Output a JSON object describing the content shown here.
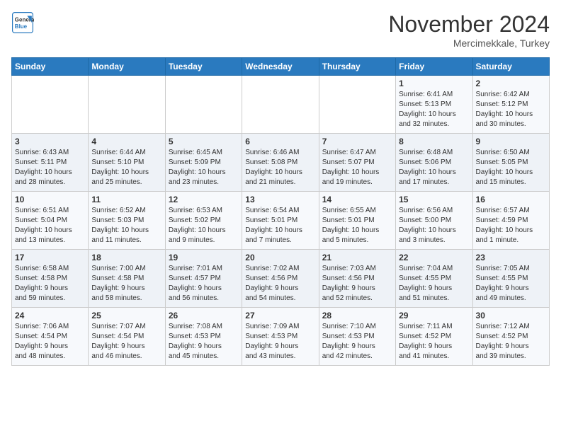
{
  "header": {
    "logo_line1": "General",
    "logo_line2": "Blue",
    "month": "November 2024",
    "location": "Mercimekkale, Turkey"
  },
  "weekdays": [
    "Sunday",
    "Monday",
    "Tuesday",
    "Wednesday",
    "Thursday",
    "Friday",
    "Saturday"
  ],
  "weeks": [
    [
      {
        "day": "",
        "info": ""
      },
      {
        "day": "",
        "info": ""
      },
      {
        "day": "",
        "info": ""
      },
      {
        "day": "",
        "info": ""
      },
      {
        "day": "",
        "info": ""
      },
      {
        "day": "1",
        "info": "Sunrise: 6:41 AM\nSunset: 5:13 PM\nDaylight: 10 hours\nand 32 minutes."
      },
      {
        "day": "2",
        "info": "Sunrise: 6:42 AM\nSunset: 5:12 PM\nDaylight: 10 hours\nand 30 minutes."
      }
    ],
    [
      {
        "day": "3",
        "info": "Sunrise: 6:43 AM\nSunset: 5:11 PM\nDaylight: 10 hours\nand 28 minutes."
      },
      {
        "day": "4",
        "info": "Sunrise: 6:44 AM\nSunset: 5:10 PM\nDaylight: 10 hours\nand 25 minutes."
      },
      {
        "day": "5",
        "info": "Sunrise: 6:45 AM\nSunset: 5:09 PM\nDaylight: 10 hours\nand 23 minutes."
      },
      {
        "day": "6",
        "info": "Sunrise: 6:46 AM\nSunset: 5:08 PM\nDaylight: 10 hours\nand 21 minutes."
      },
      {
        "day": "7",
        "info": "Sunrise: 6:47 AM\nSunset: 5:07 PM\nDaylight: 10 hours\nand 19 minutes."
      },
      {
        "day": "8",
        "info": "Sunrise: 6:48 AM\nSunset: 5:06 PM\nDaylight: 10 hours\nand 17 minutes."
      },
      {
        "day": "9",
        "info": "Sunrise: 6:50 AM\nSunset: 5:05 PM\nDaylight: 10 hours\nand 15 minutes."
      }
    ],
    [
      {
        "day": "10",
        "info": "Sunrise: 6:51 AM\nSunset: 5:04 PM\nDaylight: 10 hours\nand 13 minutes."
      },
      {
        "day": "11",
        "info": "Sunrise: 6:52 AM\nSunset: 5:03 PM\nDaylight: 10 hours\nand 11 minutes."
      },
      {
        "day": "12",
        "info": "Sunrise: 6:53 AM\nSunset: 5:02 PM\nDaylight: 10 hours\nand 9 minutes."
      },
      {
        "day": "13",
        "info": "Sunrise: 6:54 AM\nSunset: 5:01 PM\nDaylight: 10 hours\nand 7 minutes."
      },
      {
        "day": "14",
        "info": "Sunrise: 6:55 AM\nSunset: 5:01 PM\nDaylight: 10 hours\nand 5 minutes."
      },
      {
        "day": "15",
        "info": "Sunrise: 6:56 AM\nSunset: 5:00 PM\nDaylight: 10 hours\nand 3 minutes."
      },
      {
        "day": "16",
        "info": "Sunrise: 6:57 AM\nSunset: 4:59 PM\nDaylight: 10 hours\nand 1 minute."
      }
    ],
    [
      {
        "day": "17",
        "info": "Sunrise: 6:58 AM\nSunset: 4:58 PM\nDaylight: 9 hours\nand 59 minutes."
      },
      {
        "day": "18",
        "info": "Sunrise: 7:00 AM\nSunset: 4:58 PM\nDaylight: 9 hours\nand 58 minutes."
      },
      {
        "day": "19",
        "info": "Sunrise: 7:01 AM\nSunset: 4:57 PM\nDaylight: 9 hours\nand 56 minutes."
      },
      {
        "day": "20",
        "info": "Sunrise: 7:02 AM\nSunset: 4:56 PM\nDaylight: 9 hours\nand 54 minutes."
      },
      {
        "day": "21",
        "info": "Sunrise: 7:03 AM\nSunset: 4:56 PM\nDaylight: 9 hours\nand 52 minutes."
      },
      {
        "day": "22",
        "info": "Sunrise: 7:04 AM\nSunset: 4:55 PM\nDaylight: 9 hours\nand 51 minutes."
      },
      {
        "day": "23",
        "info": "Sunrise: 7:05 AM\nSunset: 4:55 PM\nDaylight: 9 hours\nand 49 minutes."
      }
    ],
    [
      {
        "day": "24",
        "info": "Sunrise: 7:06 AM\nSunset: 4:54 PM\nDaylight: 9 hours\nand 48 minutes."
      },
      {
        "day": "25",
        "info": "Sunrise: 7:07 AM\nSunset: 4:54 PM\nDaylight: 9 hours\nand 46 minutes."
      },
      {
        "day": "26",
        "info": "Sunrise: 7:08 AM\nSunset: 4:53 PM\nDaylight: 9 hours\nand 45 minutes."
      },
      {
        "day": "27",
        "info": "Sunrise: 7:09 AM\nSunset: 4:53 PM\nDaylight: 9 hours\nand 43 minutes."
      },
      {
        "day": "28",
        "info": "Sunrise: 7:10 AM\nSunset: 4:53 PM\nDaylight: 9 hours\nand 42 minutes."
      },
      {
        "day": "29",
        "info": "Sunrise: 7:11 AM\nSunset: 4:52 PM\nDaylight: 9 hours\nand 41 minutes."
      },
      {
        "day": "30",
        "info": "Sunrise: 7:12 AM\nSunset: 4:52 PM\nDaylight: 9 hours\nand 39 minutes."
      }
    ]
  ]
}
